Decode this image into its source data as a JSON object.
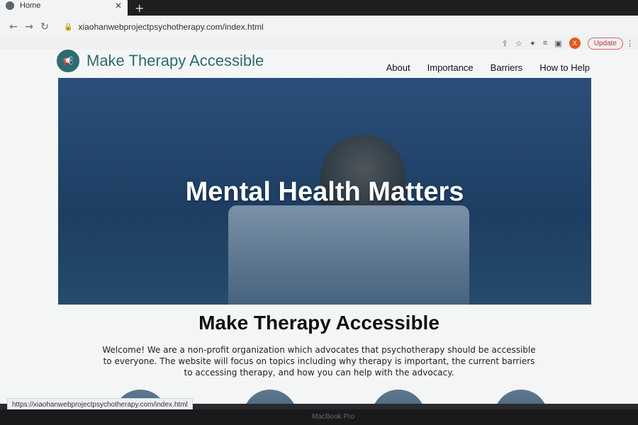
{
  "browser": {
    "tab_title": "Home",
    "new_tab": "+",
    "url": "xiaohanwebprojectpsychotherapy.com/index.html",
    "update_label": "Update",
    "avatar_letter": "X",
    "status_url": "https://xiaohanwebprojectpsychotherapy.com/index.html"
  },
  "site": {
    "brand": "Make Therapy Accessible",
    "nav": [
      "About",
      "Importance",
      "Barriers",
      "How to Help"
    ],
    "hero_title": "Mental Health Matters",
    "section_title": "Make Therapy Accessible",
    "section_text": "Welcome! We are a non-profit organization which advocates that psychotherapy should be accessible to everyone. The website will focus on topics including why therapy is important, the current barriers to accessing therapy, and how you can help with the advocacy."
  },
  "device": {
    "brand": "MacBook Pro"
  },
  "icons": {
    "back": "←",
    "forward": "→",
    "reload": "↻",
    "lock": "🔒",
    "share": "⇪",
    "star": "☆",
    "extensions": "✦",
    "list": "≡",
    "panel": "▣",
    "menu": "⋮",
    "megaphone": "📢"
  },
  "colors": {
    "accent": "#2e6c6f",
    "update": "#cc3333"
  }
}
